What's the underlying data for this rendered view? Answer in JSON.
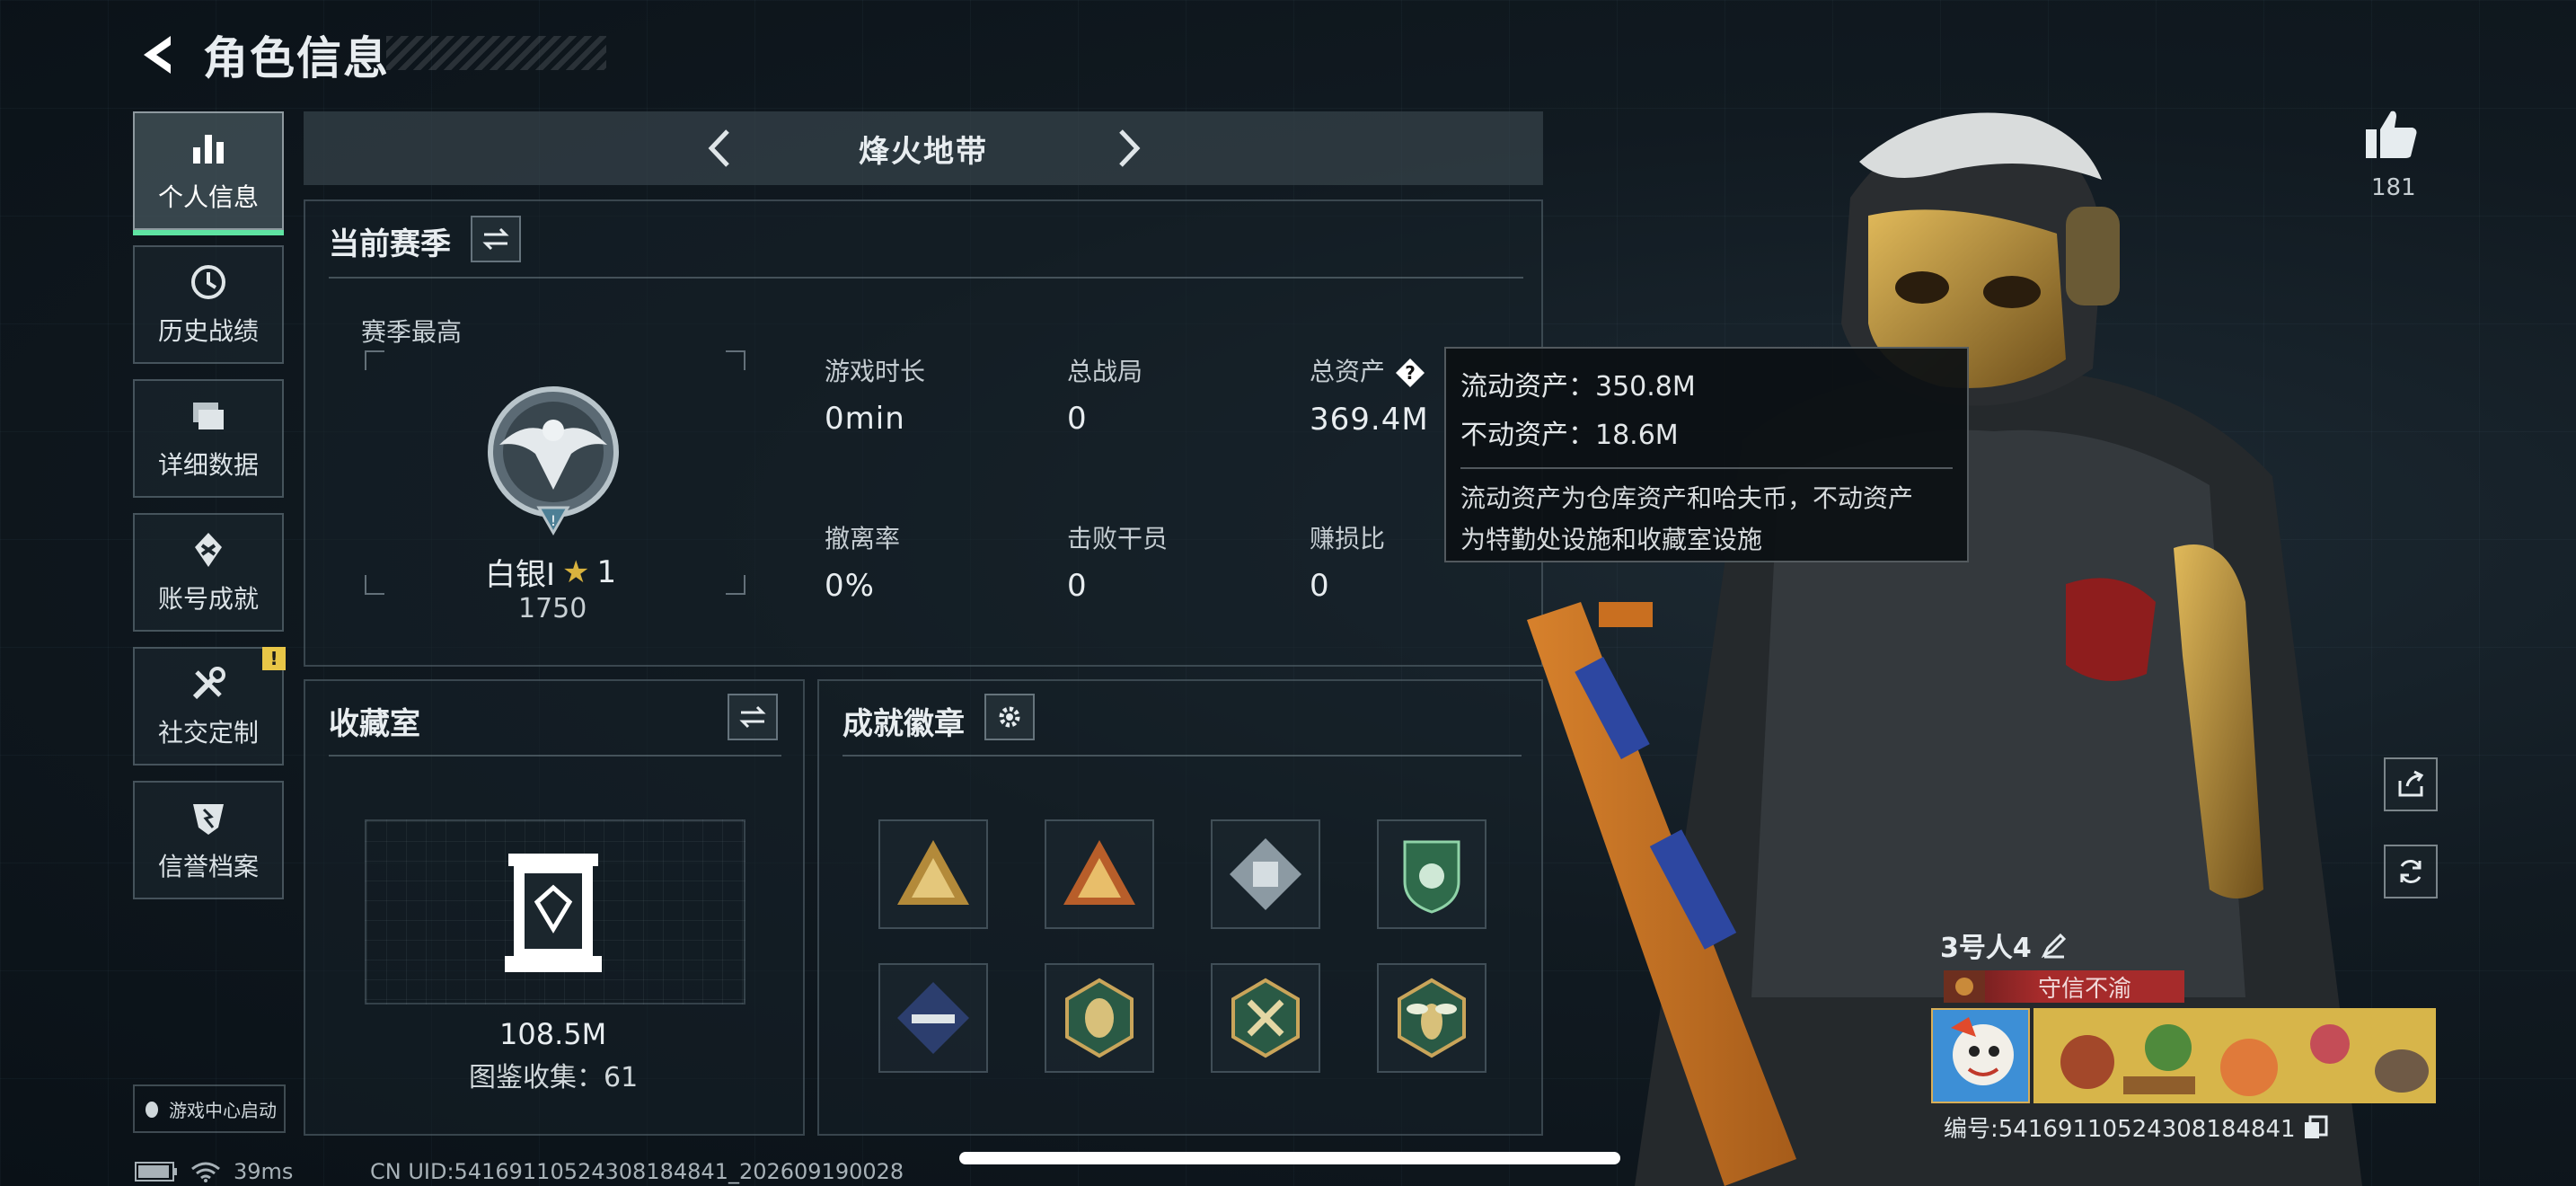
{
  "header": {
    "title": "角色信息"
  },
  "sidebar": {
    "items": [
      {
        "label": "个人信息",
        "icon": "bar-chart-icon",
        "active": true
      },
      {
        "label": "历史战绩",
        "icon": "history-icon"
      },
      {
        "label": "详细数据",
        "icon": "folders-icon"
      },
      {
        "label": "账号成就",
        "icon": "achievement-icon"
      },
      {
        "label": "社交定制",
        "icon": "tools-icon",
        "badge": "!"
      },
      {
        "label": "信誉档案",
        "icon": "shield-icon"
      }
    ],
    "game_center": "游戏中心启动"
  },
  "mode": {
    "name": "烽火地带"
  },
  "season": {
    "title": "当前赛季",
    "best_label": "赛季最高",
    "rank_name": "白银I",
    "rank_stars": "1",
    "rank_score": "1750",
    "stats": [
      {
        "label": "游戏时长",
        "value": "0min"
      },
      {
        "label": "总战局",
        "value": "0"
      },
      {
        "label": "总资产",
        "value": "369.4M"
      },
      {
        "label": "撤离率",
        "value": "0%"
      },
      {
        "label": "击败干员",
        "value": "0"
      },
      {
        "label": "赚损比",
        "value": "0"
      }
    ]
  },
  "tooltip": {
    "liquid": "流动资产：350.8M",
    "fixed": "不动资产：18.6M",
    "desc_line1": "流动资产为仓库资产和哈夫币，不动资产",
    "desc_line2": "为特勤处设施和收藏室设施"
  },
  "collection": {
    "title": "收藏室",
    "value": "108.5M",
    "count": "图鉴收集：61"
  },
  "achievements": {
    "title": "成就徽章",
    "badges": [
      "gold-triangle-badge-icon",
      "gold-orange-triangle-badge-icon",
      "silver-diamond-badge-icon",
      "green-shield-badge-icon",
      "blue-diamond-badge-icon",
      "green-hexagon-badge-icon",
      "green-hexagon-tools-badge-icon",
      "green-hexagon-wasp-badge-icon"
    ]
  },
  "profile": {
    "likes": "181",
    "name": "3号人4",
    "title_badge": "守信不渝",
    "id": "编号:5416911052430818484​1"
  },
  "status": {
    "ping": "39ms",
    "uid": "CN UID:54169110524308184841_202609190028"
  },
  "colors": {
    "accent": "#5fe3a2",
    "alert": "#e8c647",
    "title_red": "#a62b2b",
    "gold": "#d8b23e"
  }
}
